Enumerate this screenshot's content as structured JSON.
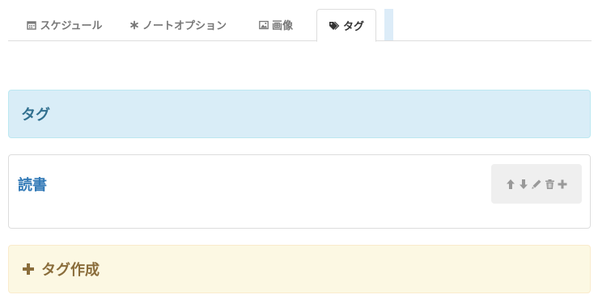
{
  "tabs": [
    {
      "label": "スケジュール",
      "icon": "calendar-icon"
    },
    {
      "label": "ノートオプション",
      "icon": "asterisk-icon"
    },
    {
      "label": "画像",
      "icon": "picture-icon"
    },
    {
      "label": "タグ",
      "icon": "tags-icon",
      "active": true
    }
  ],
  "header_panel": {
    "title": "タグ"
  },
  "tags": [
    {
      "name": "読書",
      "actions": [
        "arrow-up-icon",
        "arrow-down-icon",
        "pencil-icon",
        "trash-icon",
        "plus-icon"
      ]
    }
  ],
  "create_panel": {
    "label": "タグ作成",
    "icon": "plus-icon"
  },
  "colors": {
    "info_bg": "#d9edf7",
    "info_text": "#31708f",
    "warning_bg": "#fcf8e3",
    "warning_text": "#8a6d3b",
    "link": "#337ab7",
    "tool_icon": "#999999"
  }
}
